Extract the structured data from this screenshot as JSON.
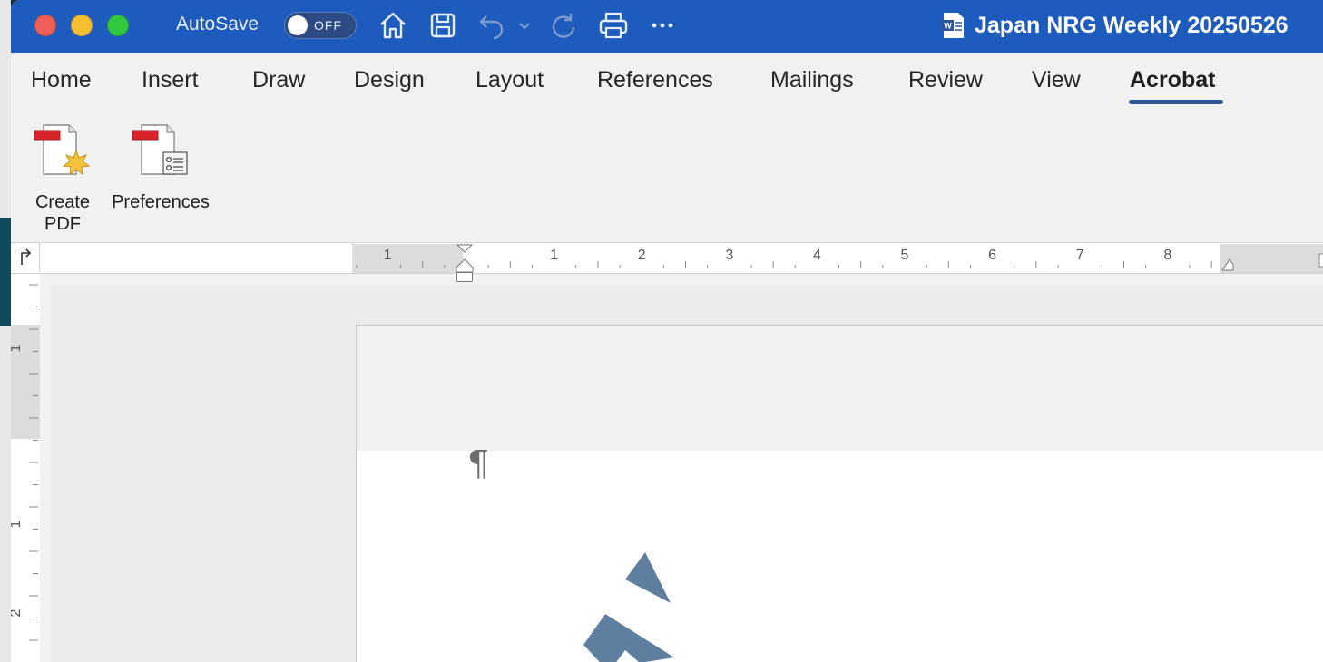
{
  "titlebar": {
    "autosave_label": "AutoSave",
    "autosave_state": "OFF",
    "document_title": "Japan NRG Weekly 20250526",
    "icons": [
      "home-icon",
      "save-icon",
      "undo-icon",
      "undo-dropdown-icon",
      "redo-icon",
      "print-icon",
      "more-icon"
    ]
  },
  "ribbon_tabs": [
    {
      "label": "Home"
    },
    {
      "label": "Insert"
    },
    {
      "label": "Draw"
    },
    {
      "label": "Design"
    },
    {
      "label": "Layout"
    },
    {
      "label": "References"
    },
    {
      "label": "Mailings"
    },
    {
      "label": "Review"
    },
    {
      "label": "View"
    },
    {
      "label": "Acrobat",
      "active": true
    }
  ],
  "ribbon": {
    "create_pdf_line1": "Create",
    "create_pdf_line2": "PDF",
    "preferences_label": "Preferences"
  },
  "ruler": {
    "horizontal_labels": [
      "1",
      "1",
      "2",
      "3",
      "4",
      "5",
      "6",
      "7",
      "8"
    ],
    "vertical_labels": [
      "1",
      "1",
      "2"
    ]
  },
  "document": {
    "paragraph_mark": "¶"
  },
  "colors": {
    "titlebar": "#1d5bbd",
    "accent_underline": "#2b579a",
    "logo": "#5f7fa0"
  }
}
